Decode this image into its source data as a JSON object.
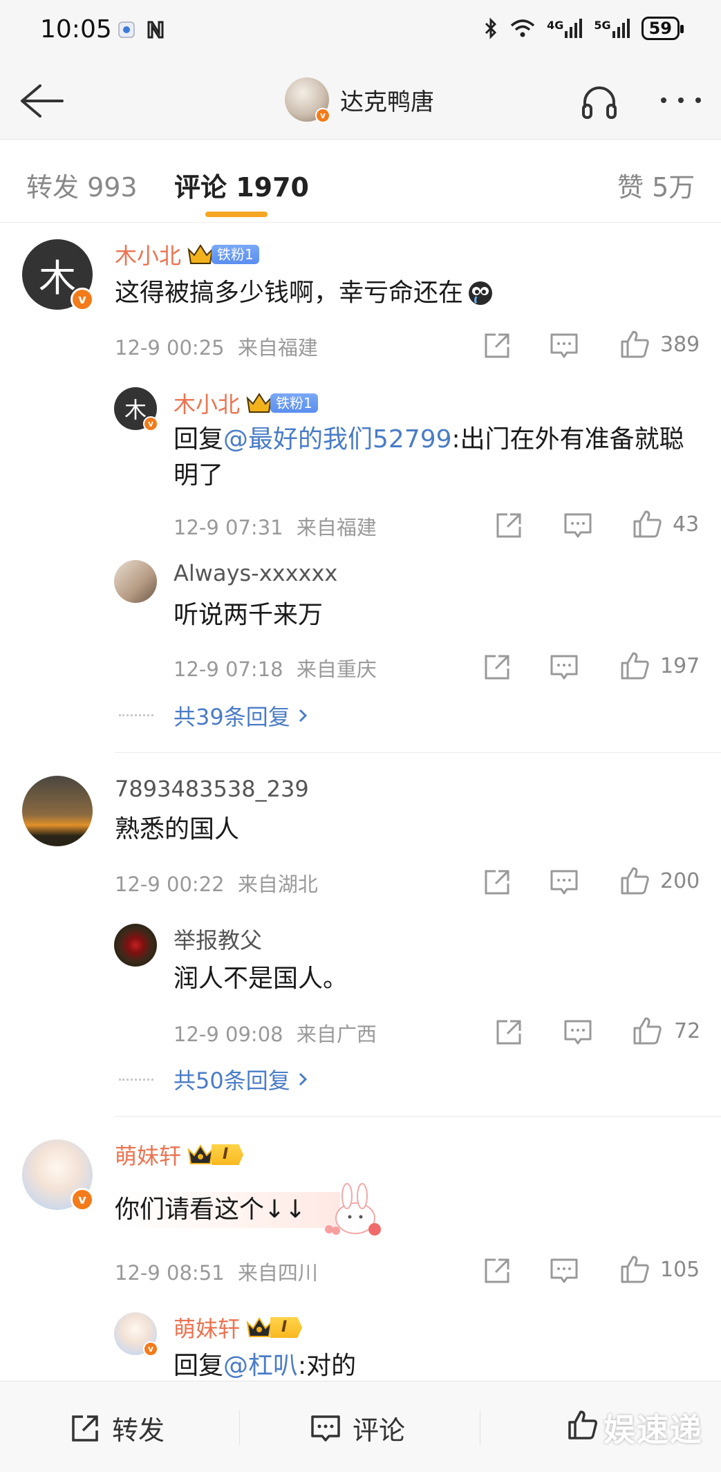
{
  "status_bar": {
    "time": "10:05",
    "network_4g": "4G",
    "network_5g": "5G",
    "battery": "59"
  },
  "nav": {
    "title": "达克鸭唐"
  },
  "tabs": {
    "repost": "转发 993",
    "comments": "评论 1970",
    "likes": "赞 5万"
  },
  "comments": [
    {
      "name": "木小北",
      "fan_badge": "铁粉1",
      "text": "这得被搞多少钱啊，幸亏命还在",
      "emoji": "crying-face-emoji",
      "time": "12-9 00:25",
      "location": "来自福建",
      "likes": "389",
      "replies": [
        {
          "name": "木小北",
          "fan_badge": "铁粉1",
          "reply_prefix": "回复",
          "mention": "@最好的我们52799",
          "text": ":出门在外有准备就聪明了",
          "time": "12-9 07:31",
          "location": "来自福建",
          "likes": "43"
        },
        {
          "name": "Always-xxxxxx",
          "text": "听说两千来万",
          "time": "12-9 07:18",
          "location": "来自重庆",
          "likes": "197"
        }
      ],
      "more_replies": "共39条回复"
    },
    {
      "name": "7893483538_239",
      "text": "熟悉的国人",
      "time": "12-9 00:22",
      "location": "来自湖北",
      "likes": "200",
      "replies": [
        {
          "name": "举报教父",
          "text": "润人不是国人。",
          "time": "12-9 09:08",
          "location": "来自广西",
          "likes": "72"
        }
      ],
      "more_replies": "共50条回复"
    },
    {
      "name": "萌妹轩",
      "level_badge": "I",
      "text": "你们请看这个↓↓",
      "time": "12-9 08:51",
      "location": "来自四川",
      "likes": "105",
      "replies": [
        {
          "name": "萌妹轩",
          "level_badge": "I",
          "reply_prefix": "回复",
          "mention": "@杠叭",
          "text": ":对的"
        }
      ]
    }
  ],
  "bottom_bar": {
    "repost": "转发",
    "comment": "评论"
  },
  "watermark": "娱速递",
  "colors": {
    "username_orange": "#eb7350",
    "link_blue": "#4a7cc7",
    "tab_underline": "#f5a623",
    "verified_badge": "#f47b1a"
  }
}
